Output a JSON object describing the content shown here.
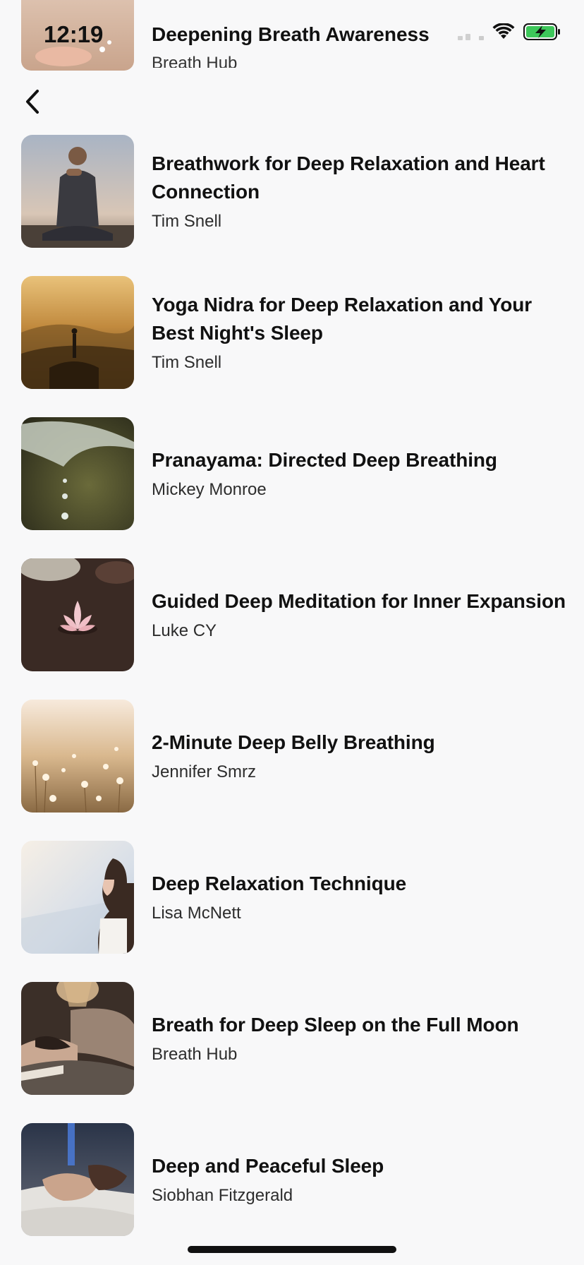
{
  "status": {
    "time": "12:19"
  },
  "peek_item": {
    "title": "Deepening Breath Awareness",
    "author": "Breath Hub"
  },
  "nav": {
    "back_icon": "chevron-left-icon"
  },
  "items": [
    {
      "title": "Breathwork for Deep Relaxation and Heart Connection",
      "author": "Tim Snell",
      "thumb": "man-meditating-mountain"
    },
    {
      "title": "Yoga Nidra for Deep Relaxation and Your Best Night's Sleep",
      "author": "Tim Snell",
      "thumb": "person-yoga-pose-sunset-hills"
    },
    {
      "title": "Pranayama: Directed Deep Breathing",
      "author": "Mickey Monroe",
      "thumb": "leaf-water-drops"
    },
    {
      "title": "Guided Deep Meditation for Inner Expansion",
      "author": "Luke CY",
      "thumb": "lotus-flower-dark-water"
    },
    {
      "title": "2-Minute Deep Belly Breathing",
      "author": "Jennifer Smrz",
      "thumb": "wildflowers-field"
    },
    {
      "title": "Deep Relaxation Technique",
      "author": "Lisa McNett",
      "thumb": "woman-breathing-seaside"
    },
    {
      "title": "Breath for Deep Sleep on the Full Moon",
      "author": "Breath Hub",
      "thumb": "woman-sleeping-lamp"
    },
    {
      "title": "Deep and Peaceful Sleep",
      "author": "Siobhan Fitzgerald",
      "thumb": "woman-sleeping-blue-light"
    }
  ]
}
